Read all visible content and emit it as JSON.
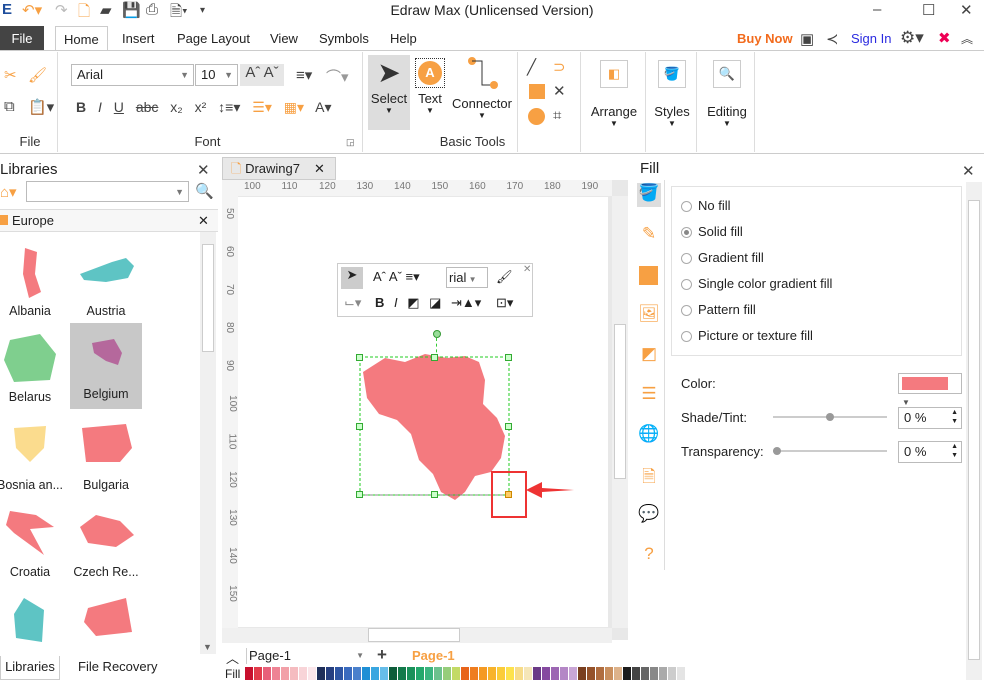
{
  "app": {
    "title": "Edraw Max (Unlicensed Version)"
  },
  "menu": {
    "tabs": [
      "File",
      "Home",
      "Insert",
      "Page Layout",
      "View",
      "Symbols",
      "Help"
    ],
    "buy_now": "Buy Now",
    "sign_in": "Sign In"
  },
  "ribbon": {
    "font_name": "Arial",
    "font_size": "10",
    "groups": {
      "file": "File",
      "font": "Font",
      "basic_tools": "Basic Tools"
    },
    "tools": {
      "select": "Select",
      "text": "Text",
      "connector": "Connector",
      "arrange": "Arrange",
      "styles": "Styles",
      "editing": "Editing"
    }
  },
  "libraries": {
    "title": "Libraries",
    "search_value": "",
    "category": "Europe",
    "items": [
      "Albania",
      "Austria",
      "Belarus",
      "Belgium",
      "Bosnia an...",
      "Bulgaria",
      "Croatia",
      "Czech Re..."
    ],
    "bottom_tabs": [
      "Libraries",
      "File Recovery"
    ]
  },
  "document": {
    "tab": "Drawing7",
    "h_ruler": [
      "100",
      "110",
      "120",
      "130",
      "140",
      "150",
      "160",
      "170",
      "180",
      "190"
    ],
    "v_ruler": [
      "50",
      "60",
      "70",
      "80",
      "90",
      "100",
      "110",
      "120",
      "130",
      "140",
      "150"
    ],
    "float_font": "rial",
    "page_select": "Page-1",
    "page_tab": "Page-1",
    "fill_label": "Fill"
  },
  "fill_panel": {
    "title": "Fill",
    "options": [
      "No fill",
      "Solid fill",
      "Gradient fill",
      "Single color gradient fill",
      "Pattern fill",
      "Picture or texture fill"
    ],
    "selected": "Solid fill",
    "color_label": "Color:",
    "color": "#f47a7f",
    "shade_label": "Shade/Tint:",
    "shade_value": "0 %",
    "transparency_label": "Transparency:",
    "transparency_value": "0 %"
  },
  "palette": [
    "#c8102e",
    "#e23b4b",
    "#e8607a",
    "#ee8394",
    "#f2a0a8",
    "#f5bcc0",
    "#f8d4d8",
    "#fbe6ea",
    "#1f2f5a",
    "#263f80",
    "#2e55a3",
    "#3a6bbf",
    "#4a80cc",
    "#1e8fd5",
    "#39a6e0",
    "#66bde9",
    "#0d5d3a",
    "#137a4a",
    "#1a915a",
    "#23a86c",
    "#3ab57f",
    "#6cc18e",
    "#96cd7a",
    "#c3da66",
    "#e8641b",
    "#ef7d1f",
    "#f59a23",
    "#f8b32b",
    "#fbcc39",
    "#fde24d",
    "#f7dc8a",
    "#f5e6b8",
    "#6a3a87",
    "#854aa0",
    "#9c66b3",
    "#b487c6",
    "#c9a6d6",
    "#7a3f1f",
    "#95522a",
    "#b06d3f",
    "#c98f5e",
    "#ddb28a",
    "#1c1c1c",
    "#444444",
    "#666666",
    "#888888",
    "#aaaaaa",
    "#cccccc",
    "#e4e4e4"
  ]
}
